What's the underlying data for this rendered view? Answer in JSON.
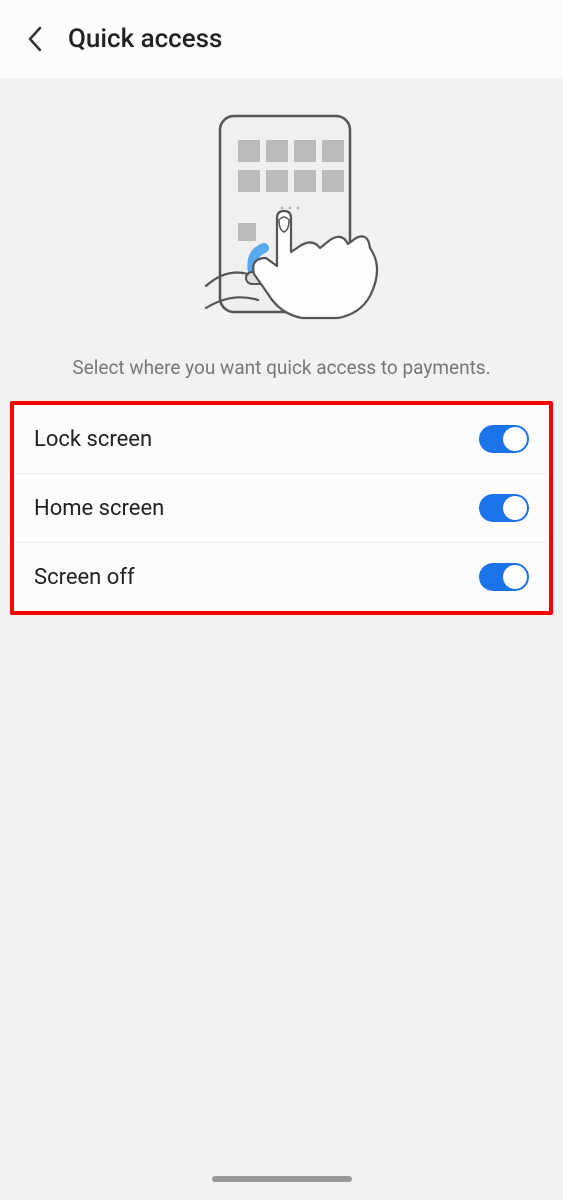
{
  "header": {
    "title": "Quick access"
  },
  "description": "Select where you want quick access to payments.",
  "options": [
    {
      "label": "Lock screen",
      "on": true
    },
    {
      "label": "Home screen",
      "on": true
    },
    {
      "label": "Screen off",
      "on": true
    }
  ]
}
